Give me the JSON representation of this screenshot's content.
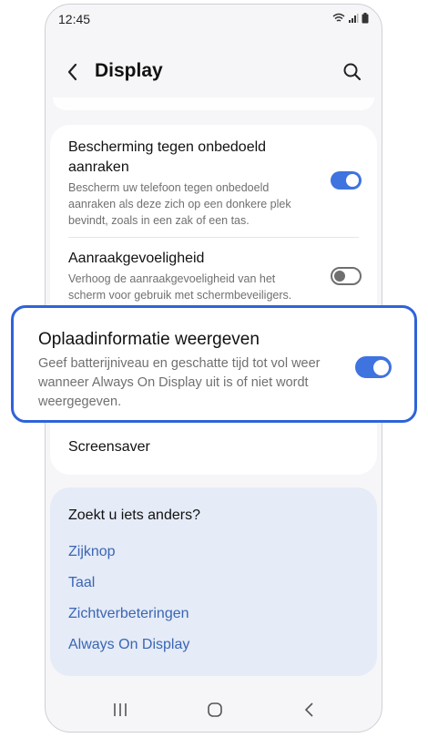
{
  "status_bar": {
    "time": "12:45"
  },
  "header": {
    "title": "Display"
  },
  "settings": [
    {
      "title": "Bescherming tegen onbedoeld aanraken",
      "description": "Bescherm uw telefoon tegen onbedoeld aanraken als deze zich op een donkere plek bevindt, zoals in een zak of een tas.",
      "toggle": "on"
    },
    {
      "title": "Aanraakgevoeligheid",
      "description": "Verhoog de aanraakgevoeligheid van het scherm voor gebruik met schermbeveiligers.",
      "toggle": "off"
    },
    {
      "title": "Oplaadinformatie weergeven",
      "description": "Geef batterijniveau en geschatte tijd tot vol weer wanneer Always On Display uit is of niet wordt weergegeven.",
      "toggle": "on"
    },
    {
      "title": "Screensaver"
    }
  ],
  "suggestions": {
    "title": "Zoekt u iets anders?",
    "links": [
      "Zijknop",
      "Taal",
      "Zichtverbeteringen",
      "Always On Display"
    ]
  },
  "colors": {
    "accent": "#3e73e0",
    "highlight_border": "#2f63d8",
    "link": "#3a66b3",
    "suggest_bg": "#e5ebf7"
  }
}
